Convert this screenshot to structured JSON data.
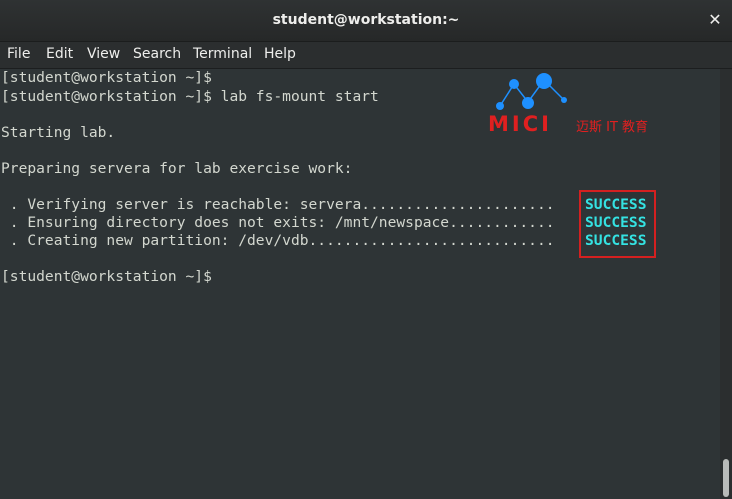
{
  "window": {
    "title": "student@workstation:~",
    "close_icon": "close-icon"
  },
  "menubar": {
    "items": [
      "File",
      "Edit",
      "View",
      "Search",
      "Terminal",
      "Help"
    ]
  },
  "terminal": {
    "lines": [
      "[student@workstation ~]$",
      "[student@workstation ~]$ lab fs-mount start",
      "",
      "Starting lab.",
      "",
      "Preparing servera for lab exercise work:",
      "",
      " . Verifying server is reachable: servera......................",
      " . Ensuring directory does not exits: /mnt/newspace............",
      " . Creating new partition: /dev/vdb............................",
      "",
      "[student@workstation ~]$"
    ],
    "statuses": [
      "SUCCESS",
      "SUCCESS",
      "SUCCESS"
    ]
  },
  "watermark": {
    "brand": "MICI",
    "subtitle": "迈斯 IT 教育"
  },
  "colors": {
    "background": "#2e3436",
    "text": "#d3d7cf",
    "success": "#34e2e2",
    "highlight_border": "#d42020",
    "watermark": "#e02020",
    "watermark_dots": "#1e90ff"
  }
}
